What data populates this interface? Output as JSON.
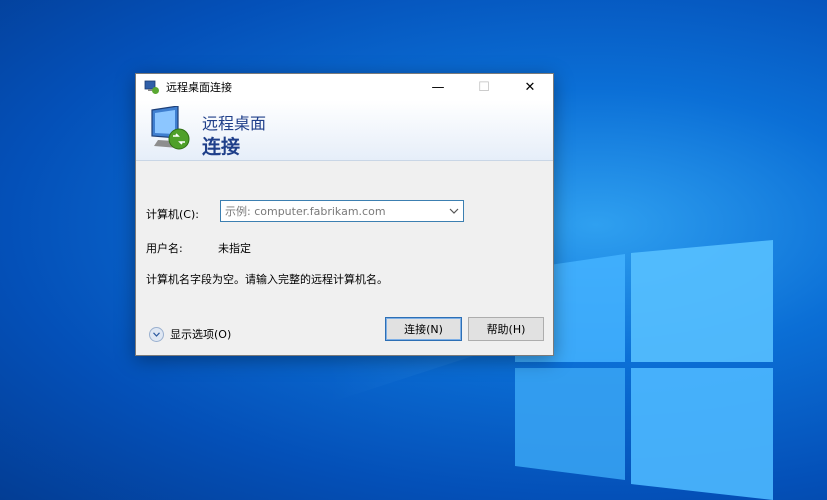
{
  "window": {
    "title": "远程桌面连接",
    "minimize": "—",
    "maximize": "☐",
    "close": "✕"
  },
  "banner": {
    "line1": "远程桌面",
    "line2": "连接"
  },
  "form": {
    "computer_label": "计算机(C):",
    "computer_value": "",
    "computer_placeholder": "示例: computer.fabrikam.com",
    "username_label": "用户名:",
    "username_value": "未指定",
    "message": "计算机名字段为空。请输入完整的远程计算机名。"
  },
  "footer": {
    "show_options": "显示选项(O)",
    "connect_button": "连接(N)",
    "help_button": "帮助(H)"
  },
  "icons": {
    "title_icon": "remote-desktop-icon",
    "banner_icon": "remote-desktop-monitor-icon",
    "dropdown_icon": "chevron-down-icon",
    "options_icon": "chevron-down-circle-icon"
  }
}
